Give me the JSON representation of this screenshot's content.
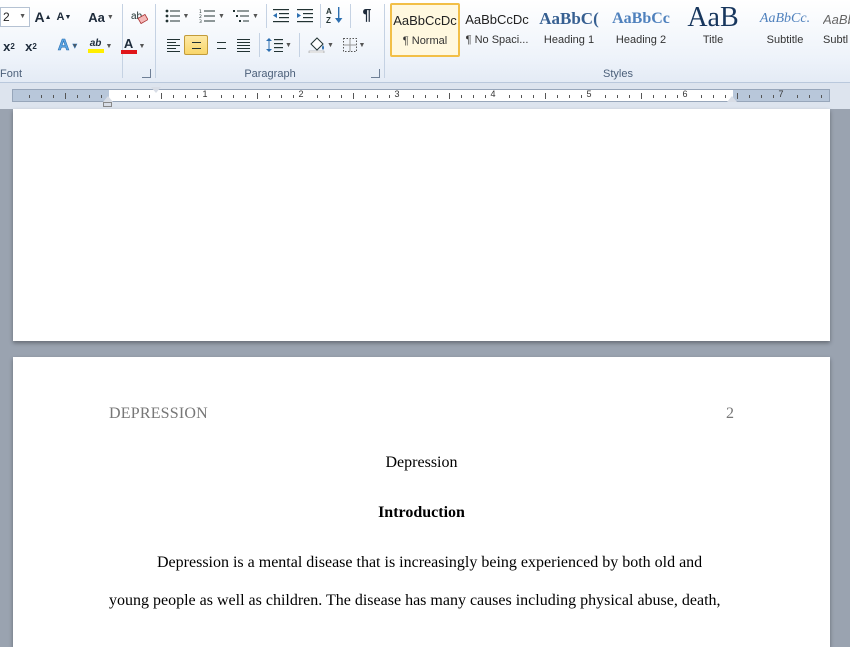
{
  "ribbon": {
    "font_group": {
      "label": "Font",
      "font_size": "2",
      "grow_label": "A",
      "shrink_label": "A",
      "change_case_label": "Aa",
      "subscript_label": "x",
      "superscript_label": "x",
      "text_effects_label": "A",
      "highlight_label": "ab",
      "font_color_label": "A",
      "highlight_color": "#ffee00",
      "font_color": "#e0161a"
    },
    "paragraph_group": {
      "label": "Paragraph",
      "sort_label": "A\nZ",
      "show_marks_label": "¶",
      "active_alignment": "center"
    },
    "styles_group": {
      "label": "Styles",
      "tiles": [
        {
          "sample": "AaBbCcDc",
          "name": "¶ Normal"
        },
        {
          "sample": "AaBbCcDc",
          "name": "¶ No Spaci..."
        },
        {
          "sample": "AaBbC(",
          "name": "Heading 1"
        },
        {
          "sample": "AaBbCc",
          "name": "Heading 2"
        },
        {
          "sample": "AaB",
          "name": "Title"
        },
        {
          "sample": "AaBbCc.",
          "name": "Subtitle"
        },
        {
          "sample": "AaBbCc",
          "name": "Subtl"
        }
      ]
    }
  },
  "ruler": {
    "numbers": [
      "1",
      "2",
      "3",
      "4",
      "5",
      "6",
      "7"
    ]
  },
  "document": {
    "header_text": "DEPRESSION",
    "page_number": "2",
    "title": "Depression",
    "heading": "Introduction",
    "paragraph_lines": [
      "Depression is a mental disease that is increasingly  being experienced by both old and",
      "young people as well as children. The disease has many causes including physical abuse, death,"
    ]
  },
  "colors": {
    "ribbon_bg": "#eef3fa",
    "selected_style_border": "#f2bf47",
    "active_button": "#f9d66a",
    "workspace_bg": "#9aa3b0"
  }
}
